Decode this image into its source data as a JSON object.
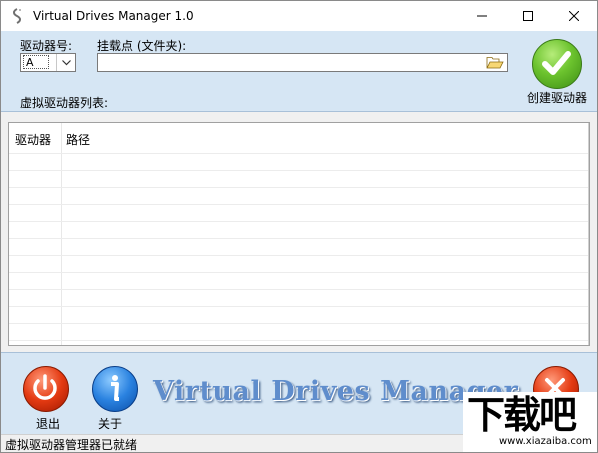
{
  "window": {
    "title": "Virtual Drives Manager 1.0",
    "icon": "app-icon"
  },
  "top_panel": {
    "drive_label": "驱动器号:",
    "drive_value": "A",
    "mount_label": "挂载点 (文件夹):",
    "mount_value": "",
    "list_label": "虚拟驱动器列表:",
    "create_label": "创建驱动器"
  },
  "table": {
    "columns": [
      "驱动器",
      "路径"
    ],
    "rows": []
  },
  "bottom_panel": {
    "exit_label": "退出",
    "about_label": "关于",
    "banner": "Virtual Drives Manager"
  },
  "status": {
    "text": "虚拟驱动器管理器已就绪"
  },
  "watermark": {
    "main": "下载吧",
    "sub": "www.xiazaiba.com"
  },
  "colors": {
    "panel": "#d6e6f4",
    "green": "#6cc32e",
    "red": "#e43a12",
    "blue": "#2a82e0",
    "banner": "#5f8dcc"
  }
}
